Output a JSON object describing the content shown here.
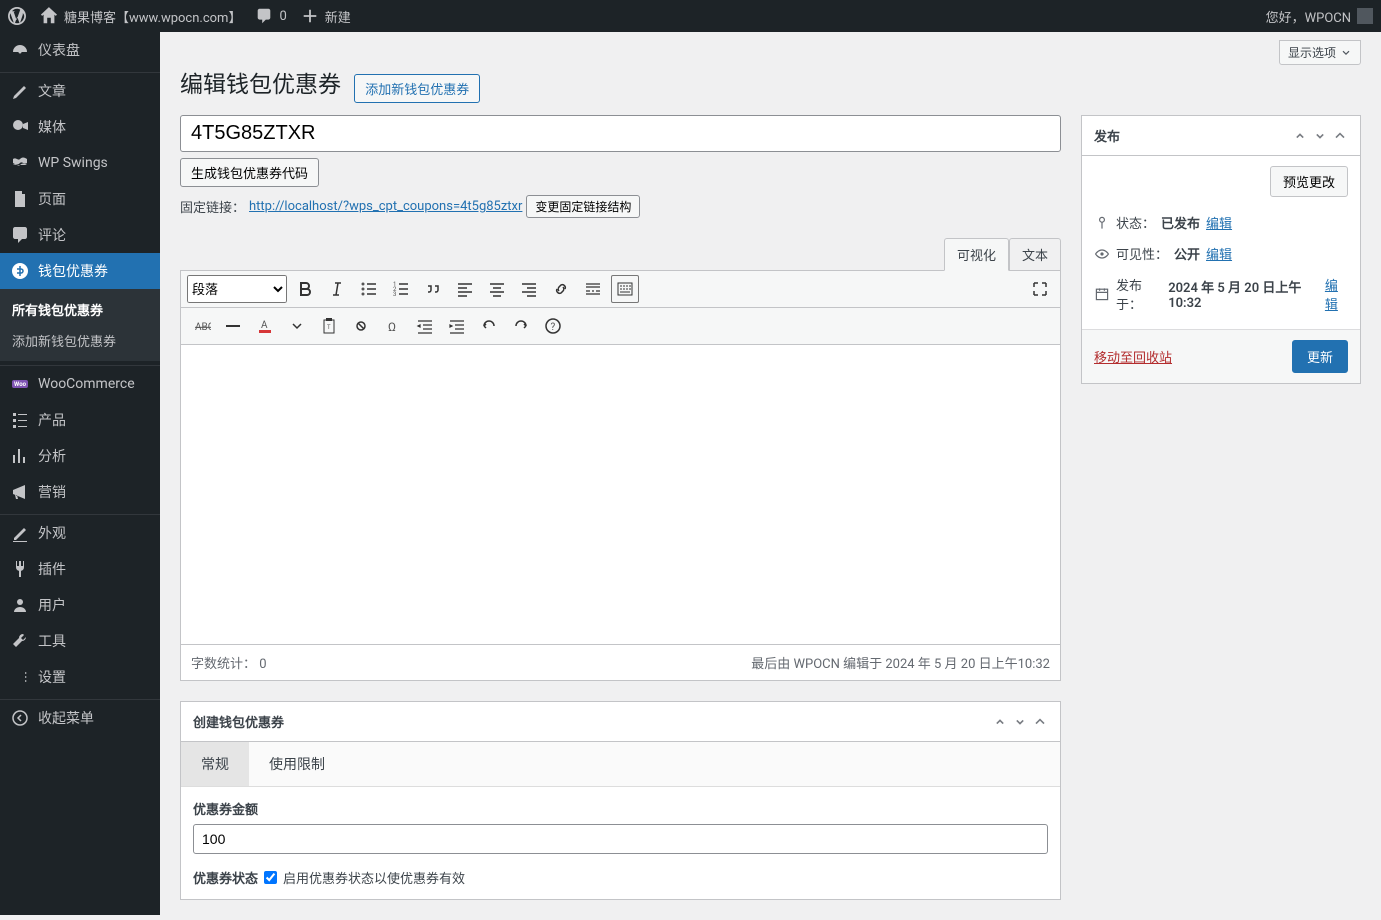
{
  "adminbar": {
    "site_name": "糖果博客【www.wpocn.com】",
    "comments_count": "0",
    "new_label": "新建",
    "greeting": "您好，WPOCN"
  },
  "sidebar": {
    "items": [
      {
        "label": "仪表盘",
        "icon": "dashboard"
      },
      {
        "label": "文章",
        "icon": "posts"
      },
      {
        "label": "媒体",
        "icon": "media"
      },
      {
        "label": "WP Swings",
        "icon": "swings"
      },
      {
        "label": "页面",
        "icon": "pages"
      },
      {
        "label": "评论",
        "icon": "comments"
      },
      {
        "label": "钱包优惠券",
        "icon": "wallet",
        "current": true
      },
      {
        "label": "WooCommerce",
        "icon": "woo"
      },
      {
        "label": "产品",
        "icon": "products"
      },
      {
        "label": "分析",
        "icon": "analytics"
      },
      {
        "label": "营销",
        "icon": "marketing"
      },
      {
        "label": "外观",
        "icon": "appearance"
      },
      {
        "label": "插件",
        "icon": "plugins"
      },
      {
        "label": "用户",
        "icon": "users"
      },
      {
        "label": "工具",
        "icon": "tools"
      },
      {
        "label": "设置",
        "icon": "settings"
      },
      {
        "label": "收起菜单",
        "icon": "collapse"
      }
    ],
    "submenu": [
      {
        "label": "所有钱包优惠券",
        "current": true
      },
      {
        "label": "添加新钱包优惠券"
      }
    ]
  },
  "screen_options": "显示选项",
  "page": {
    "title": "编辑钱包优惠券",
    "action": "添加新钱包优惠券"
  },
  "post": {
    "title_value": "4T5G85ZTXR",
    "generate_btn": "生成钱包优惠券代码",
    "permalink_label": "固定链接：",
    "permalink_url": "http://localhost/?wps_cpt_coupons=4t5g85ztxr",
    "permalink_edit": "变更固定链接结构"
  },
  "editor": {
    "tab_visual": "可视化",
    "tab_text": "文本",
    "format_select": "段落",
    "wordcount_label": "字数统计：",
    "wordcount": "0",
    "last_edited": "最后由 WPOCN 编辑于 2024 年 5 月 20 日上午10:32"
  },
  "metabox": {
    "title": "创建钱包优惠券",
    "tab_general": "常规",
    "tab_usage": "使用限制",
    "amount_label": "优惠券金额",
    "amount_value": "100",
    "status_label": "优惠券状态",
    "status_hint": "启用优惠券状态以使优惠券有效"
  },
  "publish": {
    "title": "发布",
    "preview_btn": "预览更改",
    "status_label": "状态：",
    "status_value": "已发布",
    "visibility_label": "可见性：",
    "visibility_value": "公开",
    "published_label": "发布于：",
    "published_value": "2024 年 5 月 20 日上午 10:32",
    "edit_link": "编辑",
    "trash_link": "移动至回收站",
    "update_btn": "更新"
  }
}
